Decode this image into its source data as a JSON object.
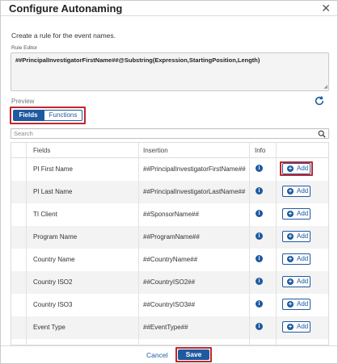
{
  "dialog": {
    "title": "Configure Autonaming",
    "subtitle": "Create a rule for the event names.",
    "rule_editor_label": "Rule Editor",
    "rule_text": "##PrincipalInvestigatorFirstName##@Substring(Expression,StartingPosition,Length)",
    "preview_label": "Preview"
  },
  "tabs": [
    {
      "label": "Fields",
      "active": true
    },
    {
      "label": "Functions",
      "active": false
    }
  ],
  "search": {
    "placeholder": "Search",
    "value": ""
  },
  "table": {
    "headers": {
      "fields": "Fields",
      "insertion": "Insertion",
      "info": "Info"
    },
    "rows": [
      {
        "field": "PI First Name",
        "insertion": "##PrincipalInvestigatorFirstName##",
        "button": "Add"
      },
      {
        "field": "PI Last Name",
        "insertion": "##PrincipalInvestigatorLastName##",
        "button": "Add"
      },
      {
        "field": "TI Client",
        "insertion": "##SponsorName##",
        "button": "Add"
      },
      {
        "field": "Program Name",
        "insertion": "##ProgramName##",
        "button": "Add"
      },
      {
        "field": "Country Name",
        "insertion": "##CountryName##",
        "button": "Add"
      },
      {
        "field": "Country ISO2",
        "insertion": "##CountryISO2##",
        "button": "Add"
      },
      {
        "field": "Country ISO3",
        "insertion": "##CountryISO3##",
        "button": "Add"
      },
      {
        "field": "Event Type",
        "insertion": "##EventType##",
        "button": "Add"
      }
    ]
  },
  "footer": {
    "cancel_label": "Cancel",
    "save_label": "Save"
  },
  "colors": {
    "accent": "#1e5aa0",
    "highlight": "#c0272d"
  }
}
